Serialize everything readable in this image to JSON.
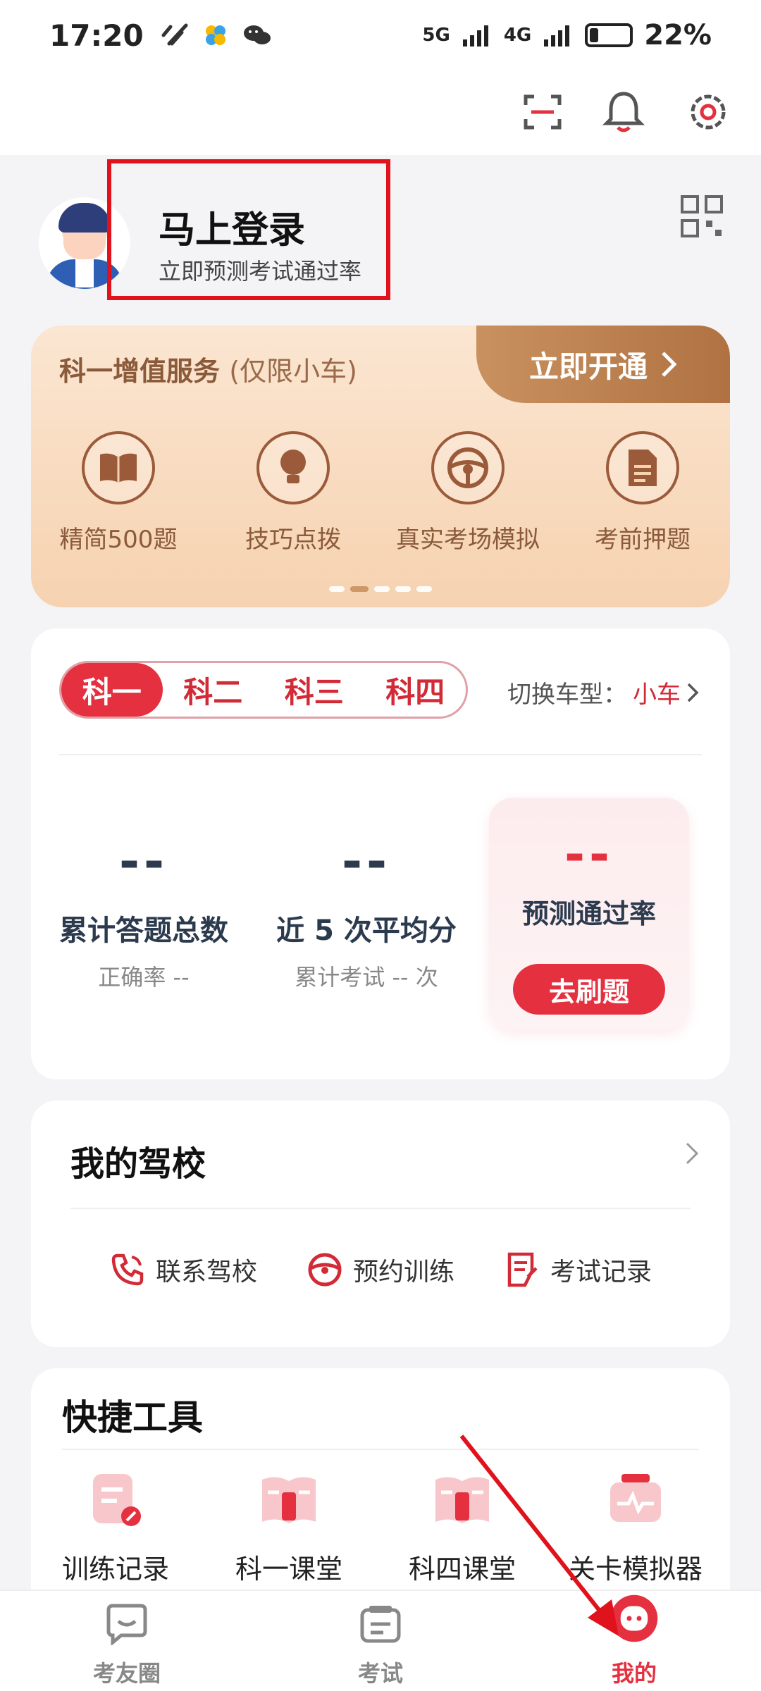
{
  "status_bar": {
    "time": "17:20",
    "signal_5g": "5G",
    "signal_4g": "4G",
    "battery": "22%",
    "battery_level": 0.22
  },
  "profile": {
    "login_title": "马上登录",
    "login_subtitle": "立即预测考试通过率"
  },
  "service": {
    "title": "科一增值服务",
    "note": "(仅限小车)",
    "open_button": "立即开通",
    "items": [
      {
        "label": "精简500题",
        "icon": "book-icon"
      },
      {
        "label": "技巧点拨",
        "icon": "lightbulb-icon"
      },
      {
        "label": "真实考场模拟",
        "icon": "steering-wheel-icon"
      },
      {
        "label": "考前押题",
        "icon": "document-icon"
      }
    ]
  },
  "subjects": {
    "tabs": [
      "科一",
      "科二",
      "科三",
      "科四"
    ],
    "active": "科一",
    "switch_label": "切换车型：",
    "car_type": "小车"
  },
  "stats": {
    "total": {
      "value": "--",
      "label": "累计答题总数",
      "sub": "正确率 --"
    },
    "average": {
      "value": "--",
      "label": "近 5 次平均分",
      "sub": "累计考试 -- 次"
    },
    "predict": {
      "value": "--",
      "label": "预测通过率",
      "button": "去刷题"
    }
  },
  "school": {
    "title": "我的驾校",
    "actions": [
      {
        "label": "联系驾校",
        "icon": "phone-icon"
      },
      {
        "label": "预约训练",
        "icon": "steering-wheel-icon"
      },
      {
        "label": "考试记录",
        "icon": "record-icon"
      }
    ]
  },
  "tools": {
    "title": "快捷工具",
    "items": [
      {
        "label": "训练记录",
        "icon": "training-record-icon"
      },
      {
        "label": "科一课堂",
        "icon": "subject-one-class-icon"
      },
      {
        "label": "科四课堂",
        "icon": "subject-four-class-icon"
      },
      {
        "label": "关卡模拟器",
        "icon": "simulator-icon"
      }
    ]
  },
  "bottom_nav": {
    "items": [
      {
        "label": "考友圈",
        "icon": "community-icon"
      },
      {
        "label": "考试",
        "icon": "exam-icon"
      },
      {
        "label": "我的",
        "icon": "mine-icon"
      }
    ],
    "active": "我的"
  },
  "colors": {
    "accent": "#e4303f",
    "annotation": "#e0121b",
    "service_brown": "#8a5a3a"
  }
}
